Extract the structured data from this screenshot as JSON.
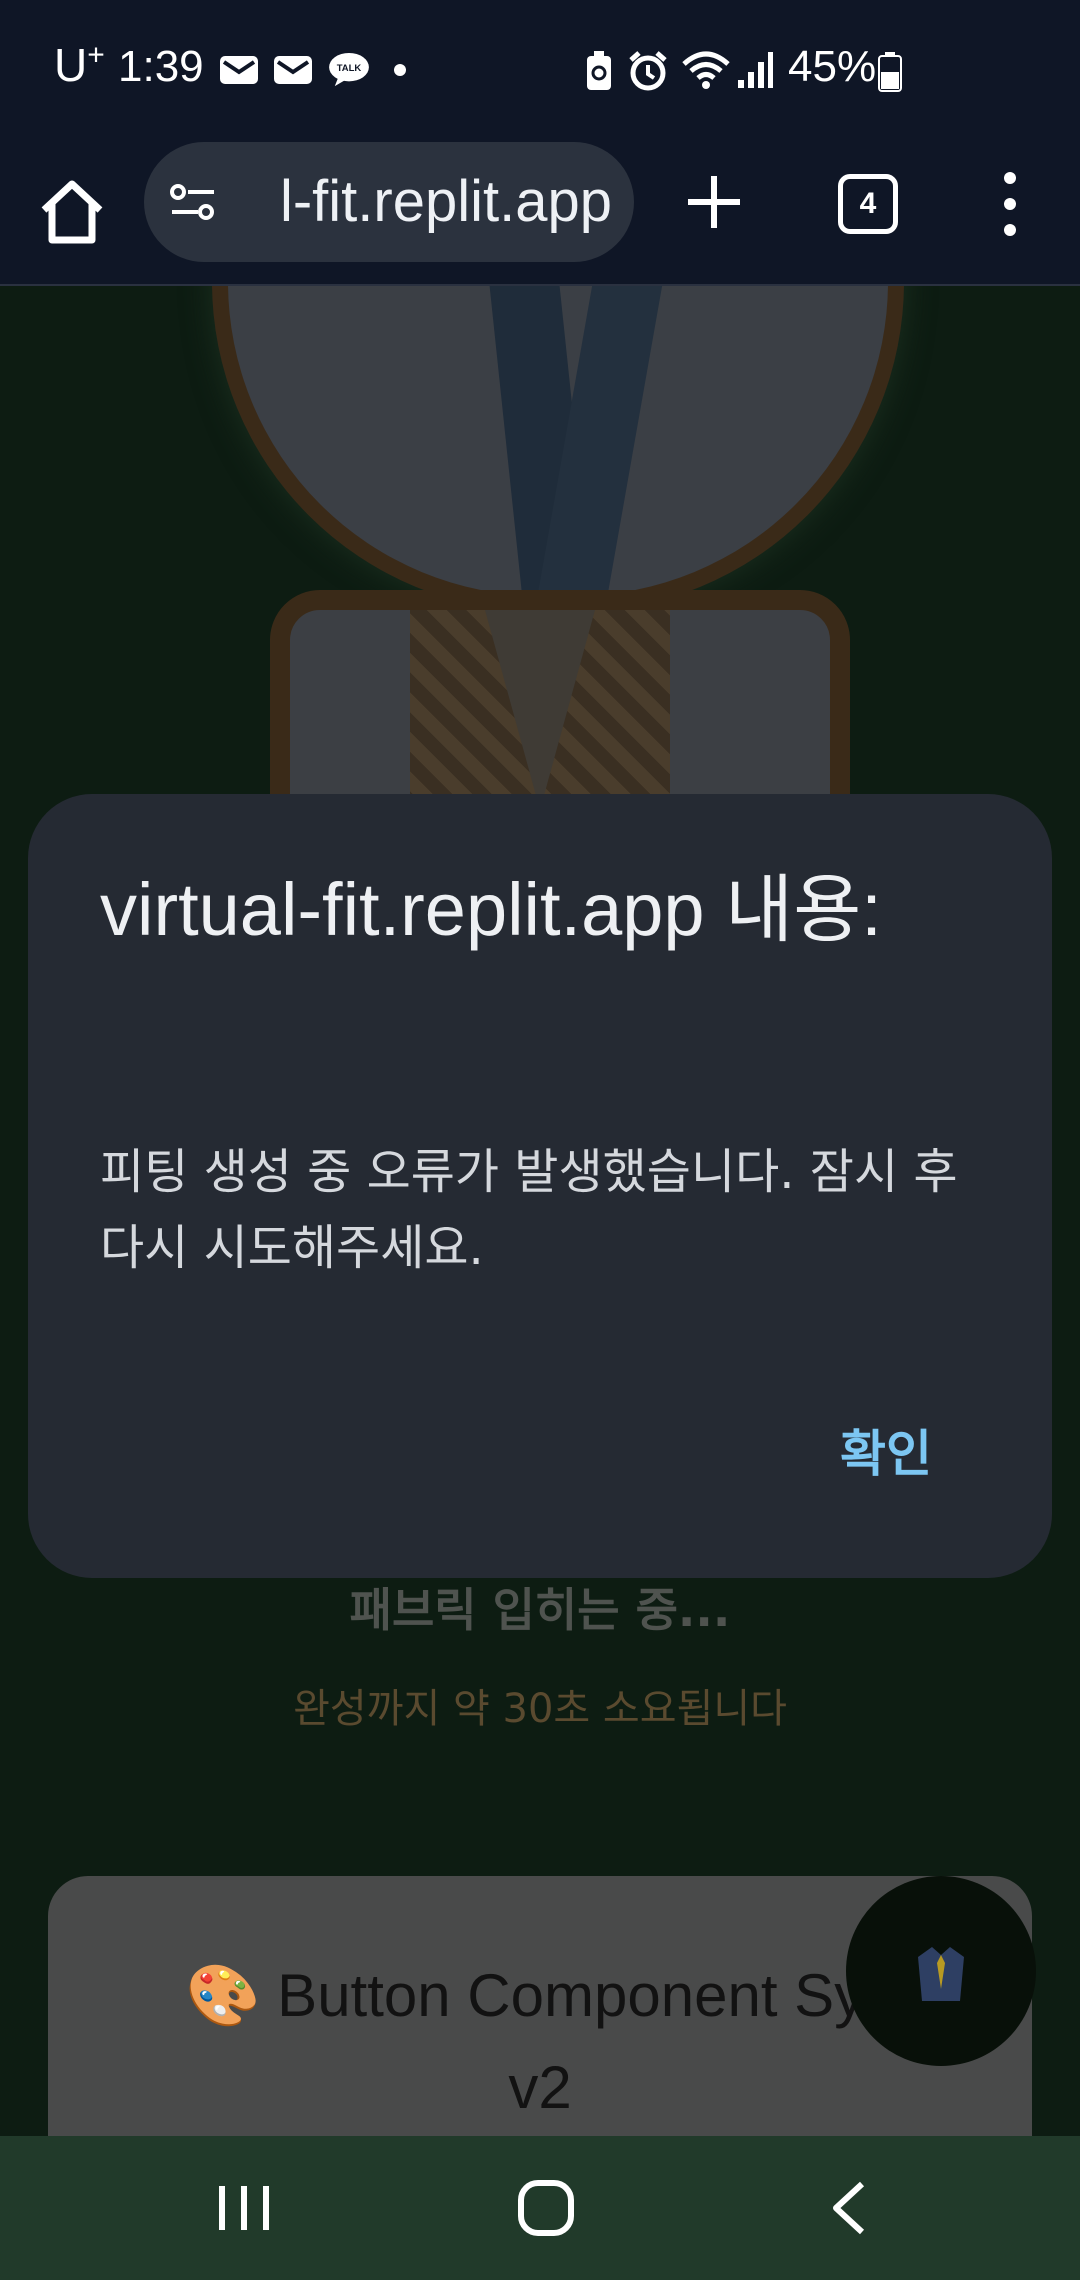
{
  "status_bar": {
    "carrier": "U",
    "carrier_sup": "+",
    "time": "1:39",
    "battery": "45%",
    "icons": [
      "mail-icon",
      "mail-icon",
      "talk-icon",
      "dot-icon",
      "battery-saver-icon",
      "alarm-icon",
      "wifi-icon",
      "signal-icon",
      "battery-icon"
    ]
  },
  "browser": {
    "url": "l-fit.replit.app",
    "tab_count": "4",
    "icons": [
      "home-icon",
      "site-info-icon",
      "plus-icon",
      "tabs-icon",
      "more-vert-icon"
    ]
  },
  "page": {
    "loading_title": "패브릭 입히는 중...",
    "loading_subtitle": "완성까지 약 30초 소요됩니다",
    "card_title_emoji": "🎨",
    "card_title": "Button Component Sys",
    "card_title_line2": "v2",
    "fab_icon": "shirt-icon"
  },
  "dialog": {
    "title": "virtual-fit.replit.app 내용:",
    "message": "피팅 생성 중 오류가 발생했습니다. 잠시 후 다시 시도해주세요.",
    "ok_label": "확인"
  },
  "nav_bar": {
    "icons": [
      "recents-icon",
      "home-icon",
      "back-icon"
    ]
  }
}
